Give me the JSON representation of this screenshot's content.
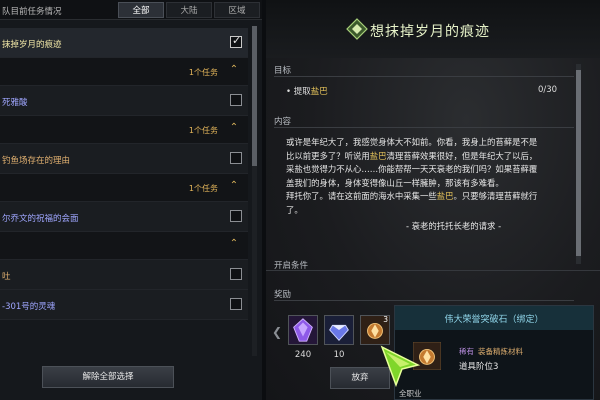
{
  "header": {
    "title": "队目前任务情况",
    "tabs": [
      {
        "label": "全部",
        "active": true
      },
      {
        "label": "大陆",
        "active": false
      },
      {
        "label": "区域",
        "active": false
      }
    ]
  },
  "quest_list": {
    "rows": [
      {
        "type": "quest",
        "name": "抹掉岁月的痕迹",
        "checked": true,
        "selected": true,
        "color": "#f2e8a8"
      },
      {
        "type": "group",
        "count": "1个任务"
      },
      {
        "type": "quest",
        "name": "死雅酸",
        "checked": false,
        "selected": false,
        "color": "#9fa6ff"
      },
      {
        "type": "group",
        "count": "1个任务"
      },
      {
        "type": "quest",
        "name": "钓鱼场存在的理由",
        "checked": false,
        "selected": false,
        "color": "#e0b070"
      },
      {
        "type": "group",
        "count": "1个任务"
      },
      {
        "type": "quest",
        "name": "尔乔文的祝福的会面",
        "checked": false,
        "selected": false,
        "color": "#9fa6ff"
      },
      {
        "type": "group",
        "count": ""
      },
      {
        "type": "quest",
        "name": "吐",
        "checked": false,
        "selected": false,
        "color": "#e0b070"
      },
      {
        "type": "quest",
        "name": "-301号的灵魂",
        "checked": false,
        "selected": false,
        "color": "#9fa6ff"
      }
    ],
    "clear_button": "解除全部选择"
  },
  "detail": {
    "title": "想抹掉岁月的痕迹",
    "objective_label": "目标",
    "objective_text_prefix": "• 提取",
    "objective_text_item": "盐巴",
    "objective_progress": "0/30",
    "content_label": "内容",
    "content_lines": [
      "或许是年纪大了，我感觉身体大不如前。你看，我身上的苔藓是不是",
      "比以前更多了？听说用盐巴清理苔藓效果很好，但是年纪大了以后，",
      "采盐也觉得力不从心……你能帮帮一天天衰老的我们吗？如果苔藓覆",
      "盖我们的身体，身体变得像山丘一样臃肿，那该有多难看。",
      "拜托你了。请在这前面的海水中采集一些盐巴。只要够清理苔藓就行",
      "了。"
    ],
    "content_highlight": "盐巴",
    "signature": "- 衰老的托托长老的请求 -",
    "next_label": "开启条件",
    "reward_label": "奖励",
    "rewards": [
      {
        "icon": "purple-crystal-icon",
        "qty": "240",
        "badge": ""
      },
      {
        "icon": "blue-gem-icon",
        "qty": "10",
        "badge": ""
      },
      {
        "icon": "orange-stone-icon",
        "qty": "",
        "badge": "3"
      }
    ],
    "abandon_button": "放弃"
  },
  "tooltip": {
    "name": "伟大荣誉突破石（绑定）",
    "rarity": "稀有",
    "category": "装备精炼材料",
    "level": "道具阶位3",
    "class": "全职业"
  },
  "colors": {
    "accent_gold": "#e4c25a",
    "title_green": "#e6f2c8",
    "tooltip_blue": "#8fd4e8"
  }
}
